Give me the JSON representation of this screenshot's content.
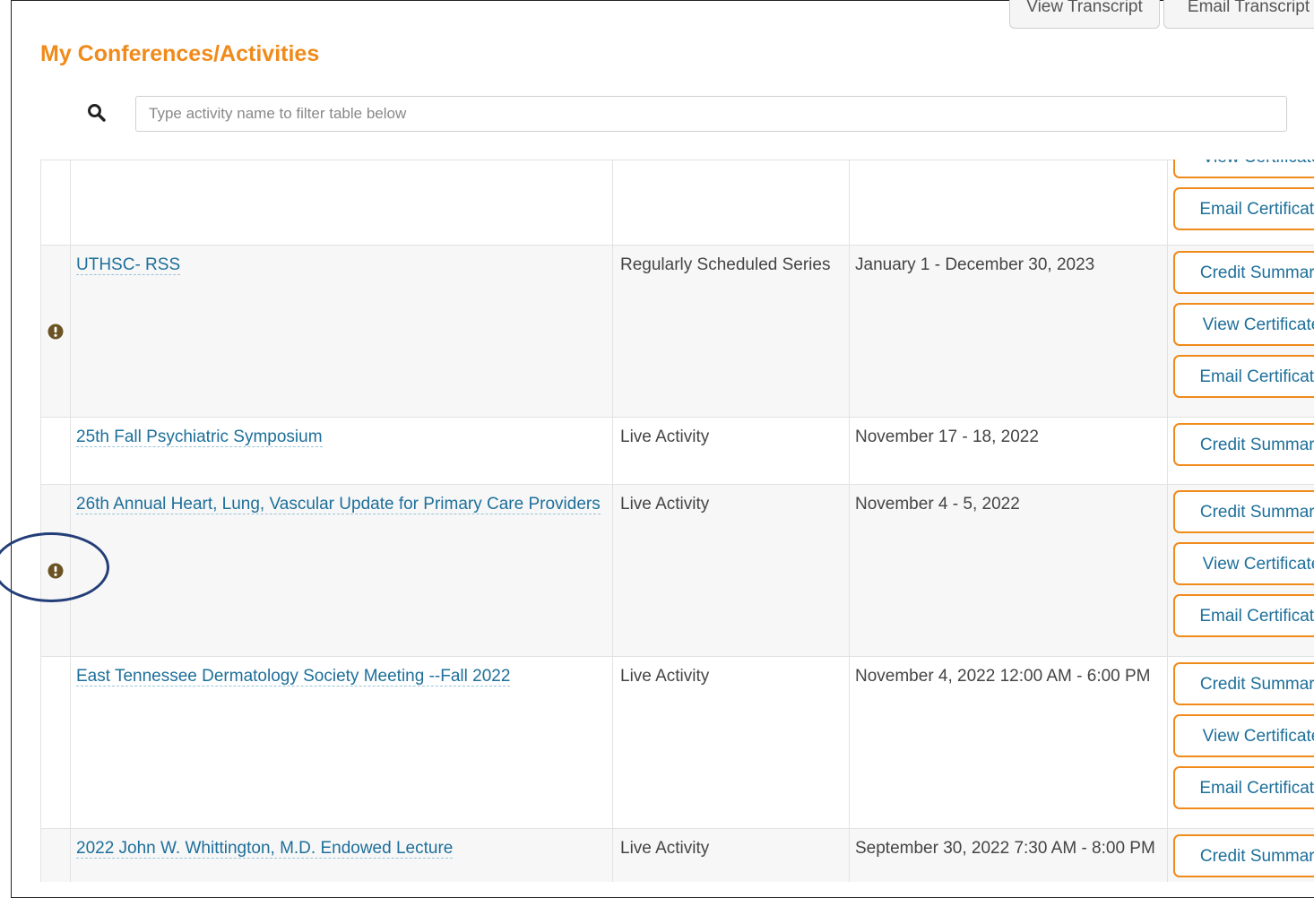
{
  "header": {
    "view_transcript_label": "View Transcript",
    "email_transcript_label": "Email Transcript"
  },
  "page_title": "My Conferences/Activities",
  "search": {
    "placeholder": "Type activity name to filter table below"
  },
  "actions": {
    "credit_summary": "Credit Summary",
    "view_certificate": "View Certificate",
    "email_certificate": "Email Certificate"
  },
  "rows": [
    {
      "name": "",
      "type": "",
      "date": "",
      "warning": false
    },
    {
      "name": "UTHSC- RSS",
      "type": "Regularly Scheduled Series",
      "date": "January 1 - December 30, 2023",
      "warning": true
    },
    {
      "name": "25th Fall Psychiatric Symposium",
      "type": "Live Activity",
      "date": "November 17 - 18, 2022",
      "warning": false
    },
    {
      "name": "26th Annual Heart, Lung, Vascular Update for Primary Care Providers",
      "type": "Live Activity",
      "date": "November 4 - 5, 2022",
      "warning": true
    },
    {
      "name": "East Tennessee Dermatology Society Meeting --Fall 2022",
      "type": "Live Activity",
      "date": "November 4, 2022 12:00 AM - 6:00 PM",
      "warning": false
    },
    {
      "name": "2022 John W. Whittington, M.D. Endowed Lecture",
      "type": "Live Activity",
      "date": "September 30, 2022 7:30 AM - 8:00 PM",
      "warning": false
    }
  ],
  "colors": {
    "accent_orange": "#f08a1a",
    "link_blue": "#1d6f9a",
    "warning_brown": "#6b5324",
    "annotation_navy": "#233e78"
  }
}
